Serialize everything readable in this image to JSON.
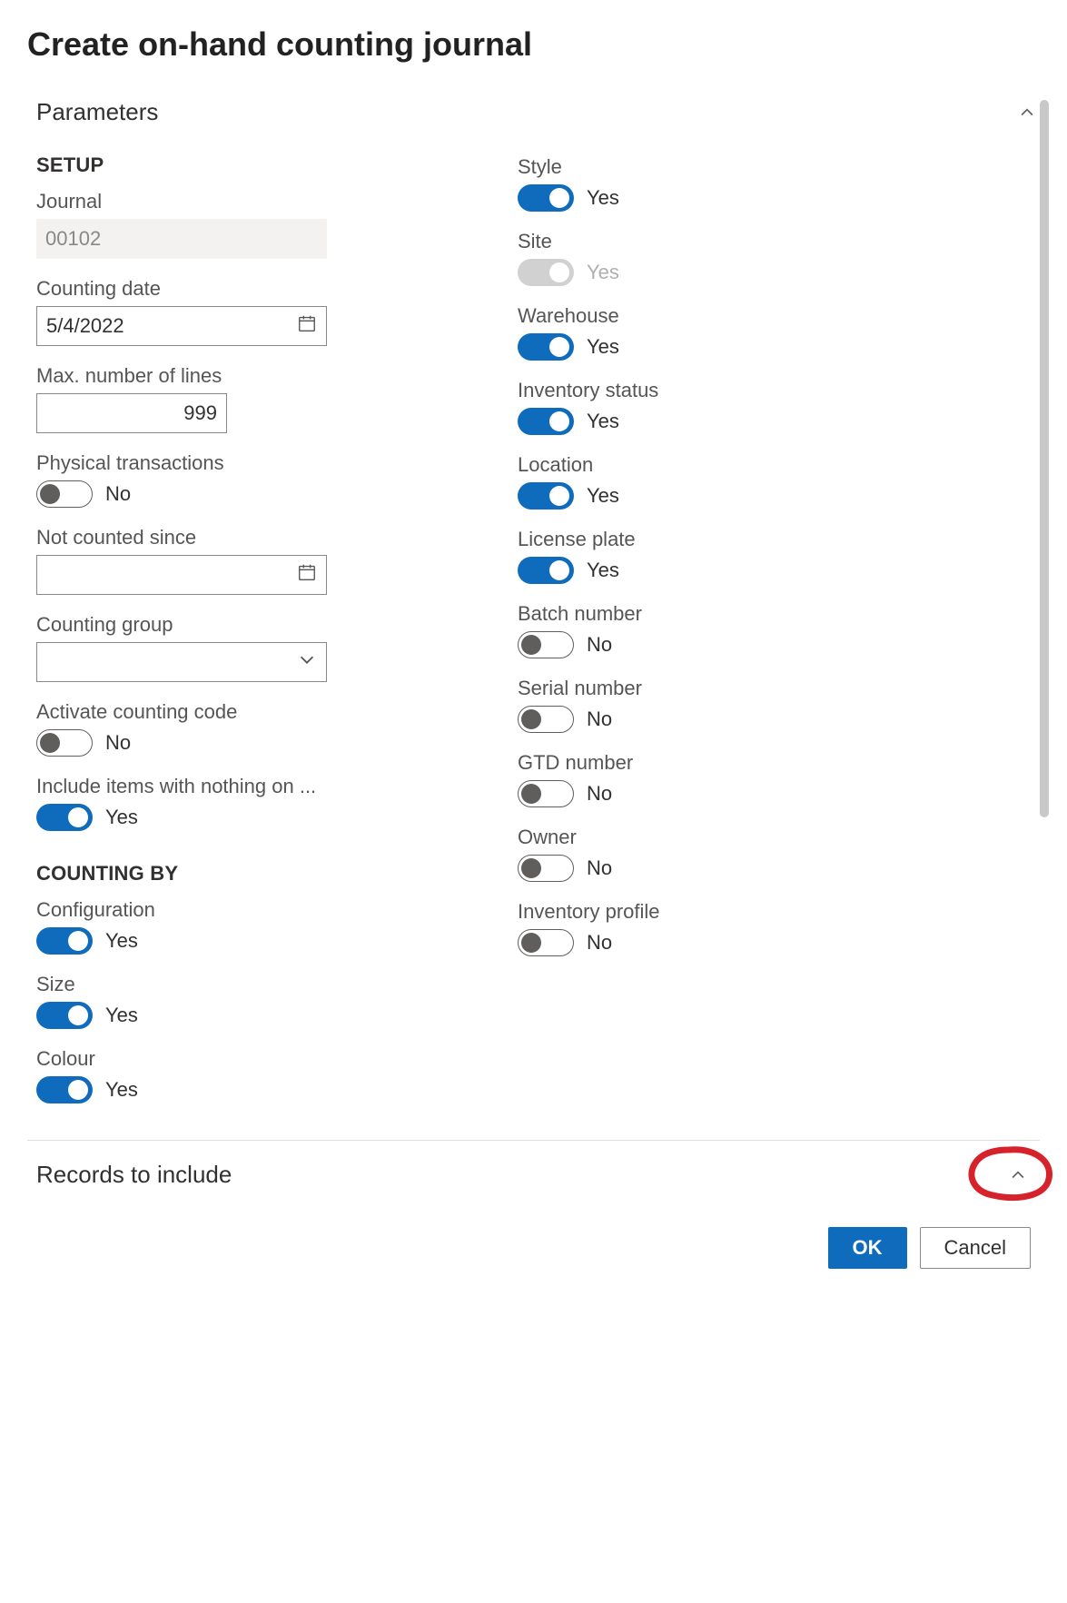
{
  "title": "Create on-hand counting journal",
  "sections": {
    "parameters": {
      "title": "Parameters"
    },
    "records": {
      "title": "Records to include"
    }
  },
  "setup": {
    "heading": "SETUP",
    "journal": {
      "label": "Journal",
      "value": "00102"
    },
    "counting_date": {
      "label": "Counting date",
      "value": "5/4/2022"
    },
    "max_lines": {
      "label": "Max. number of lines",
      "value": "999"
    },
    "physical_transactions": {
      "label": "Physical transactions",
      "state": "No"
    },
    "not_counted_since": {
      "label": "Not counted since",
      "value": ""
    },
    "counting_group": {
      "label": "Counting group",
      "value": ""
    },
    "activate_counting_code": {
      "label": "Activate counting code",
      "state": "No"
    },
    "include_nothing_onhand": {
      "label": "Include items with nothing on ...",
      "state": "Yes"
    }
  },
  "counting_by": {
    "heading": "COUNTING BY",
    "configuration": {
      "label": "Configuration",
      "state": "Yes"
    },
    "size": {
      "label": "Size",
      "state": "Yes"
    },
    "colour": {
      "label": "Colour",
      "state": "Yes"
    },
    "style": {
      "label": "Style",
      "state": "Yes"
    },
    "site": {
      "label": "Site",
      "state": "Yes",
      "disabled": true
    },
    "warehouse": {
      "label": "Warehouse",
      "state": "Yes"
    },
    "inventory_status": {
      "label": "Inventory status",
      "state": "Yes"
    },
    "location": {
      "label": "Location",
      "state": "Yes"
    },
    "license_plate": {
      "label": "License plate",
      "state": "Yes"
    },
    "batch_number": {
      "label": "Batch number",
      "state": "No"
    },
    "serial_number": {
      "label": "Serial number",
      "state": "No"
    },
    "gtd_number": {
      "label": "GTD number",
      "state": "No"
    },
    "owner": {
      "label": "Owner",
      "state": "No"
    },
    "inventory_profile": {
      "label": "Inventory profile",
      "state": "No"
    }
  },
  "buttons": {
    "ok": "OK",
    "cancel": "Cancel"
  }
}
